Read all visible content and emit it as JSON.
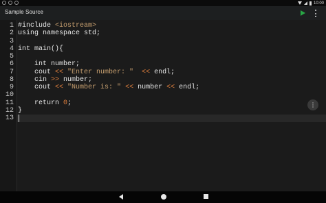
{
  "status_bar": {
    "time": "10:00"
  },
  "app_bar": {
    "title": "Sample Source"
  },
  "editor": {
    "line_numbers": [
      "1",
      "2",
      "3",
      "4",
      "5",
      "6",
      "7",
      "8",
      "9",
      "10",
      "11",
      "12",
      "13"
    ],
    "lines": [
      [
        {
          "t": "#include ",
          "c": "pp"
        },
        {
          "t": "<iostream>",
          "c": "str"
        }
      ],
      [
        {
          "t": "using namespace std;",
          "c": "kw"
        }
      ],
      [],
      [
        {
          "t": "int main(){",
          "c": "kw"
        }
      ],
      [],
      [
        {
          "t": "    int number;",
          "c": "kw"
        }
      ],
      [
        {
          "t": "    cout ",
          "c": "kw"
        },
        {
          "t": "<<",
          "c": "op"
        },
        {
          "t": " ",
          "c": "kw"
        },
        {
          "t": "\"Enter number: \"",
          "c": "str"
        },
        {
          "t": "  ",
          "c": "kw"
        },
        {
          "t": "<<",
          "c": "op"
        },
        {
          "t": " endl;",
          "c": "kw"
        }
      ],
      [
        {
          "t": "    cin ",
          "c": "kw"
        },
        {
          "t": ">>",
          "c": "op"
        },
        {
          "t": " number;",
          "c": "kw"
        }
      ],
      [
        {
          "t": "    cout ",
          "c": "kw"
        },
        {
          "t": "<<",
          "c": "op"
        },
        {
          "t": " ",
          "c": "kw"
        },
        {
          "t": "\"Number is: \"",
          "c": "str"
        },
        {
          "t": " ",
          "c": "kw"
        },
        {
          "t": "<<",
          "c": "op"
        },
        {
          "t": " number ",
          "c": "kw"
        },
        {
          "t": "<<",
          "c": "op"
        },
        {
          "t": " endl;",
          "c": "kw"
        }
      ],
      [],
      [
        {
          "t": "    return ",
          "c": "kw"
        },
        {
          "t": "0",
          "c": "num"
        },
        {
          "t": ";",
          "c": "kw"
        }
      ],
      [
        {
          "t": "}",
          "c": "kw"
        }
      ],
      []
    ],
    "current_line": 13
  },
  "icons": {
    "run": "play-icon",
    "menu": "more-vert-icon",
    "nav_back": "back-icon",
    "nav_home": "home-icon",
    "nav_recent": "recents-icon"
  },
  "colors": {
    "run_accent": "#28a745",
    "string": "#c8a070",
    "operator": "#e07f3d"
  }
}
